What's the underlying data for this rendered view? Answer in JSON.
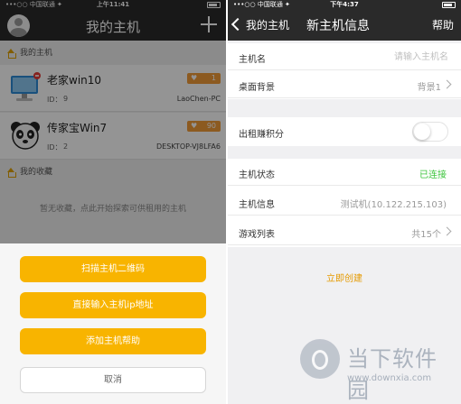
{
  "left": {
    "status": {
      "carrier": "•••○○ 中国联通 ✦",
      "time": "上午11:41"
    },
    "title": "我的主机",
    "sections": {
      "my_hosts": "我的主机",
      "favorites": "我的收藏"
    },
    "hosts": [
      {
        "name": "老家win10",
        "id_label": "ID：",
        "id": "9",
        "likes": "1",
        "pc": "LaoChen-PC"
      },
      {
        "name": "传家宝Win7",
        "id_label": "ID：",
        "id": "2",
        "likes": "90",
        "pc": "DESKTOP-VJ8LFA6"
      }
    ],
    "empty_text": "暂无收藏，点此开始探索可供租用的主机",
    "sheet": {
      "btn_scan": "扫描主机二维码",
      "btn_ip": "直接输入主机ip地址",
      "btn_help": "添加主机帮助",
      "btn_cancel": "取消"
    },
    "colors": {
      "accent": "#f8b400",
      "badge": "#f29b38",
      "navbar": "#2a2a2a"
    }
  },
  "right": {
    "status": {
      "carrier": "•••○○ 中国联通 ✦",
      "time": "下午4:37"
    },
    "back_label": "我的主机",
    "title": "新主机信息",
    "help": "帮助",
    "form": {
      "host_name_label": "主机名",
      "host_name_placeholder": "请输入主机名",
      "desktop_bg_label": "桌面背景",
      "desktop_bg_value": "背景1",
      "rent_label": "出租赚积分",
      "rent_enabled": false,
      "status_label": "主机状态",
      "status_value": "已连接",
      "info_label": "主机信息",
      "info_value": "测试机(10.122.215.103)",
      "games_label": "游戏列表",
      "games_value": "共15个"
    },
    "create_label": "立即创建",
    "colors": {
      "connected": "#3cc43c",
      "create": "#e59a00"
    }
  },
  "watermark": {
    "text": "当下软件园",
    "url": "www.downxia.com"
  }
}
